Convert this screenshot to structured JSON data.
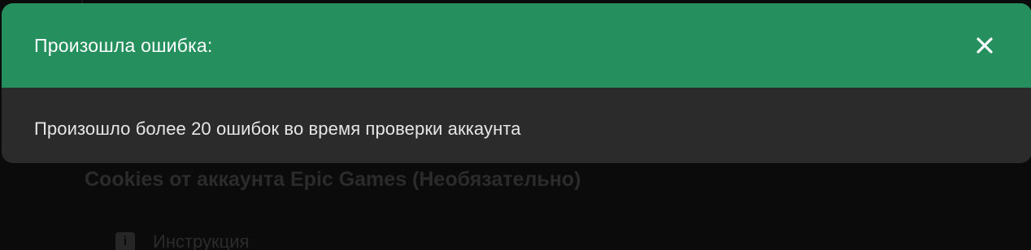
{
  "background": {
    "section_title": "Cookies от аккаунта Epic Games (Необязательно)",
    "instruction_label": "Инструкция",
    "instruction_icon": "info-icon"
  },
  "modal": {
    "title": "Произошла ошибка:",
    "message": "Произошло более 20 ошибок во время проверки аккаунта",
    "close_icon": "close-icon",
    "header_color": "#25905d",
    "body_color": "#2b2b2b"
  }
}
